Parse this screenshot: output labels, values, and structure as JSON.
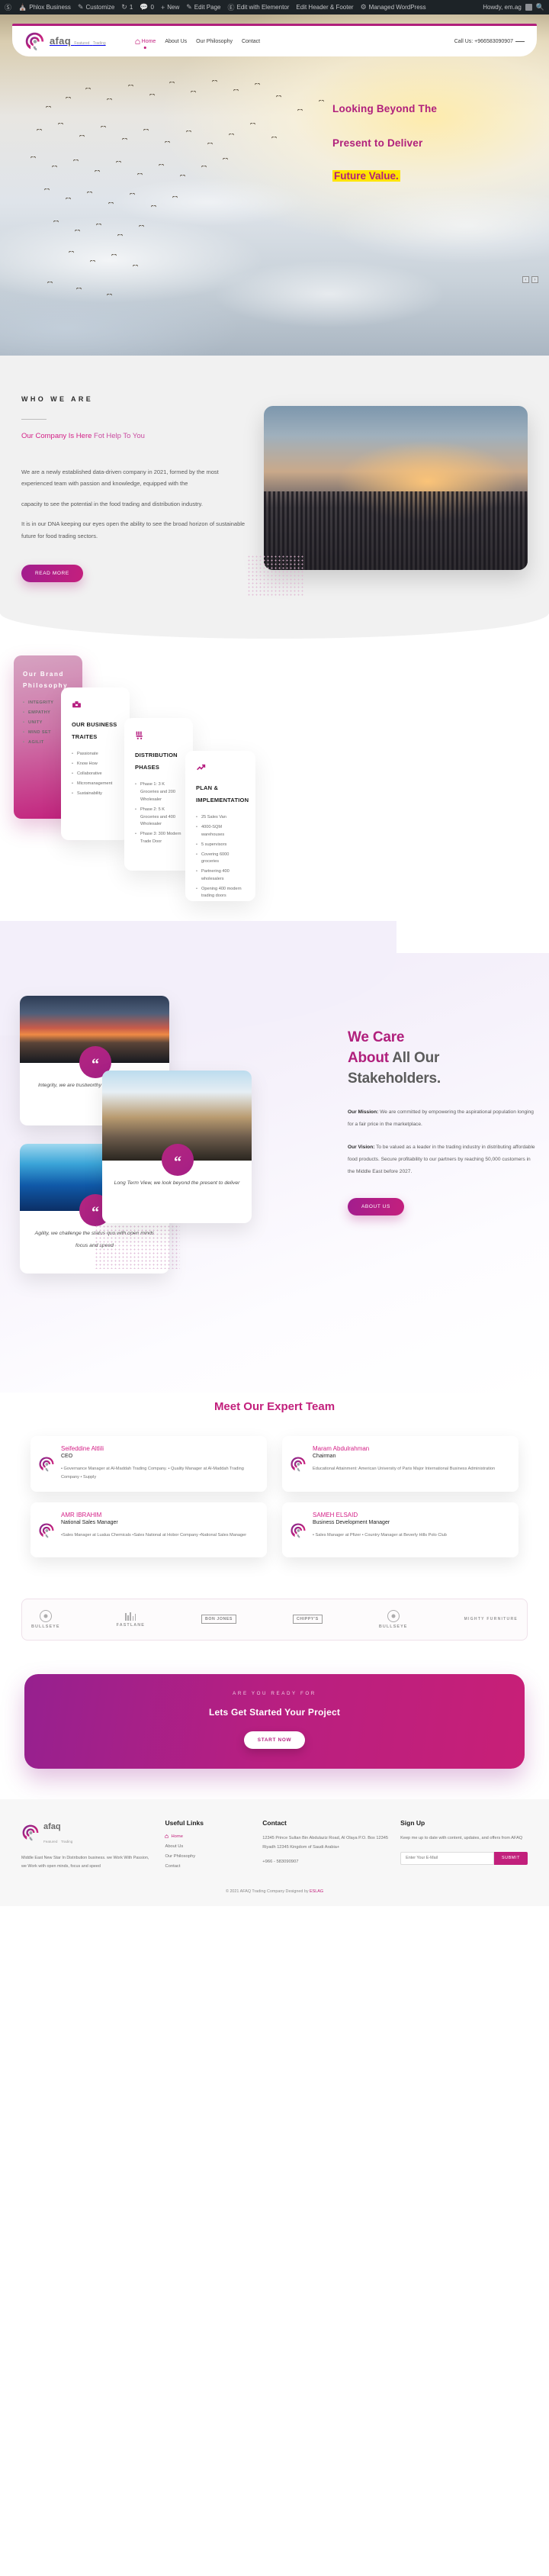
{
  "adminbar": {
    "items": [
      {
        "icon": "wordpress-icon",
        "label": ""
      },
      {
        "icon": "site-icon",
        "label": "Phlox Business"
      },
      {
        "icon": "pencil-icon",
        "label": "Customize"
      },
      {
        "icon": "refresh-icon",
        "label": "1"
      },
      {
        "icon": "comment-icon",
        "label": "0"
      },
      {
        "icon": "plus-icon",
        "label": "New"
      },
      {
        "icon": "edit-icon",
        "label": "Edit Page"
      },
      {
        "icon": "elementor-icon",
        "label": "Edit with Elementor"
      },
      {
        "icon": "",
        "label": "Edit Header & Footer"
      },
      {
        "icon": "gear-icon",
        "label": "Managed WordPress"
      }
    ],
    "howdy": "Howdy, em.ag",
    "search_icon": "search-icon"
  },
  "header": {
    "brand_name": "afaq",
    "brand_sub_line1": "Featured",
    "brand_sub_line2": "Trading",
    "nav": [
      {
        "label": "Home",
        "icon": "home-icon",
        "active": true
      },
      {
        "label": "About Us",
        "icon": "",
        "active": false
      },
      {
        "label": "Our Philosophy",
        "icon": "",
        "active": false
      },
      {
        "label": "Contact",
        "icon": "",
        "active": false
      }
    ],
    "call_us": "Call Us: +966583090907"
  },
  "hero": {
    "line1": "Looking Beyond The",
    "line2": "Present to Deliver",
    "line3": "Future Value.",
    "slider_prev": "‹",
    "slider_next": "›"
  },
  "who": {
    "eyebrow": "WHO WE ARE",
    "subtitle_strong": "Our Company Is Here",
    "subtitle_light": "Fot Help To You",
    "paragraphs": [
      "We are a newly established data-driven company in 2021, formed by the most experienced team with passion and knowledge, equipped with the",
      "capacity to see the potential in the food trading and  distribution industry.",
      "It is in our DNA keeping our eyes open the ability to see the broad horizon of sustainable future for food  trading sectors."
    ],
    "button": "READ MORE"
  },
  "cards": {
    "philosophy": {
      "title": "Our Brand Philosophy",
      "items": [
        "INTEGRITY",
        "EMPATHY",
        "UNITY",
        "MIND SET",
        "AGILIT"
      ]
    },
    "traits": {
      "icon": "briefcase-icon",
      "title": "OUR BUSINESS TRAITES",
      "items": [
        "Passionate",
        "Know How",
        "Collaborative",
        "Micromanagement",
        "Sustainability"
      ]
    },
    "distribution": {
      "icon": "warehouse-cart-icon",
      "title": "DISTRIBUTION PHASES",
      "items": [
        "Phase 1: 3 K Groceries and 200 Wholesaler",
        "Phase 2: 5 K Groceries and 400 Wholesaler",
        "Phase 3: 300 Modern Trade Door"
      ]
    },
    "plan": {
      "icon": "strategy-icon",
      "title": "PLAN & IMPLEMENTATION",
      "items": [
        "25 Sales Van",
        "4000-SQM warehouses",
        "5 supervisors",
        "Covering 6000 groceries",
        "Partnering 400 wholesalers",
        "Opening 400 modern trading doors"
      ]
    }
  },
  "stakeholders": {
    "quotes": [
      {
        "text": "Integrity, we are trustworthy and act in good faith.",
        "image": "sunset-road-image",
        "mark": "“"
      },
      {
        "text": "Long Term View, we look beyond the present to deliver",
        "image": "man-binoculars-city-image",
        "mark": "“"
      },
      {
        "text": "Agility, we challenge the status quo with open minds focus and speed",
        "image": "ai-network-face-image",
        "mark": "“"
      }
    ],
    "heading_pink_1": "We Care",
    "heading_pink_2": "About",
    "heading_rest_1": " All Our",
    "heading_rest_2": "Stakeholders.",
    "mission_label": "Our Mission:",
    "mission_text": " We are committed by empowering the  aspirational population longing for a fair price in the  marketplace.",
    "vision_label": "Our Vision:",
    "vision_text": " To be valued as a leader in the trading  industry in distributing affordable food products.  Secure profitability to our partners by reaching  50,000 customers in the Middle East before 2027.",
    "button": "ABOUT US"
  },
  "team": {
    "heading": "Meet Our Expert Team",
    "members": [
      {
        "name": "Seifeddine Altlili",
        "role": "CEO",
        "desc": "• Governance Manager at Al-Maddah Trading Company. • Quality Manager at Al-Maddah Trading Company • Supply",
        "avatar": "afaq-logo-avatar"
      },
      {
        "name": "Maram Abdulrahman",
        "role": "Chairman",
        "desc": "Educational Attainment: American University of Paris Major International Business Administration",
        "avatar": "afaq-logo-avatar"
      },
      {
        "name": "AMR IBRAHIM",
        "role": "National Sales Manager",
        "desc": "•Sales Manager at Lualua Chemicals •Sales National at Hobor Company •National Sales Manager",
        "avatar": "afaq-logo-avatar"
      },
      {
        "name": "SAMEH ELSAID",
        "role": "Business Development Manager",
        "desc": "• Sales Manager at Pfizer • Country Manager at Beverly Hills Polo Club",
        "avatar": "afaq-logo-avatar"
      }
    ]
  },
  "logos": [
    {
      "type": "ring",
      "label": "BULLSEYE"
    },
    {
      "type": "lines",
      "label": "FASTLANE"
    },
    {
      "type": "box",
      "label": "BON JONES"
    },
    {
      "type": "outline",
      "label": "CHIPPY'S"
    },
    {
      "type": "ring",
      "label": "BULLSEYE"
    },
    {
      "type": "twoline",
      "label": "MIGHTY FURNITURE"
    }
  ],
  "cta": {
    "kicker": "ARE YOU READY FOR",
    "title": "Lets Get Started Your Project",
    "button": "START NOW"
  },
  "footer": {
    "brand_name": "afaq",
    "brand_sub_line1": "Featured",
    "brand_sub_line2": "Trading",
    "brand_desc": "Middle East New Star In Distribution business.\nwe Work With Passion, we Work with open minds, focus and speed",
    "useful_links_title": "Useful Links",
    "useful_links": [
      {
        "label": "Home",
        "icon": "home-icon",
        "active": true
      },
      {
        "label": "About Us",
        "icon": "",
        "active": false
      },
      {
        "label": "Our Philosophy",
        "icon": "",
        "active": false
      },
      {
        "label": "Contact",
        "icon": "",
        "active": false
      }
    ],
    "contact_title": "Contact",
    "contact_address": "12345 Prince Sultan Bin Abdulaziz Road, Al Olaya P.O. Box 12345 Riyadh 12345 Kingdom of Saudi Arabia+",
    "contact_phone": "+966 - 583090907",
    "signup_title": "Sign Up",
    "signup_desc": "Keep me up to date with content, updates, and offers from AFAQ",
    "signup_placeholder": "Enter Your E-Mail",
    "signup_button": "SUBMIT",
    "copyright_pre": "© 2021 AFAQ Trading Company Designed by ",
    "copyright_link": "ESLAG"
  },
  "colors": {
    "brand_pink": "#c2207c",
    "brand_magenta": "#b01f7c",
    "highlight_yellow": "#ffe400",
    "dark_bar": "#1d2327"
  }
}
